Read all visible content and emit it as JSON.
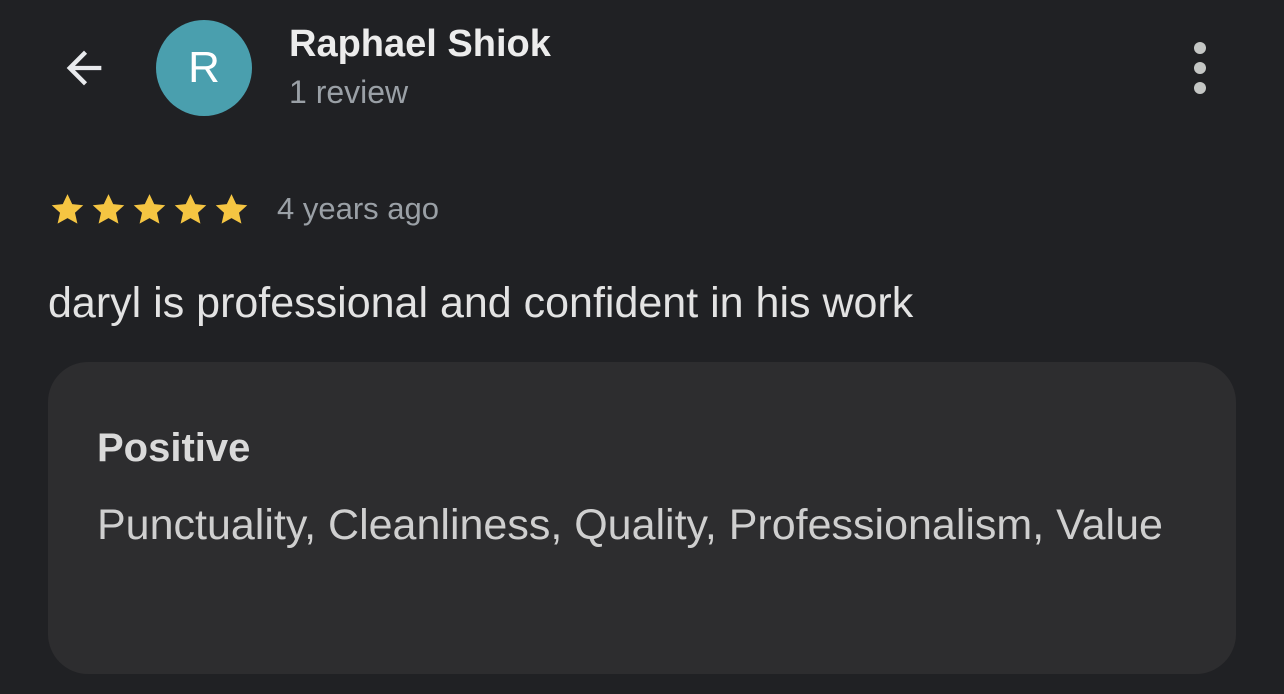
{
  "reviewer": {
    "avatar_letter": "R",
    "name": "Raphael Shiok",
    "review_count": "1 review"
  },
  "review": {
    "rating": 5,
    "max_rating": 5,
    "time_ago": "4 years ago",
    "text": "daryl is professional and confident in his work"
  },
  "attributes": {
    "title": "Positive",
    "values": "Punctuality, Cleanliness, Quality, Professionalism, Value"
  },
  "icons": {
    "back": "arrow-back-icon",
    "menu": "more-vert-icon",
    "star": "star-icon"
  },
  "colors": {
    "background": "#202124",
    "avatar": "#4a9fae",
    "star": "#f5c542",
    "card": "#2d2d2f"
  }
}
